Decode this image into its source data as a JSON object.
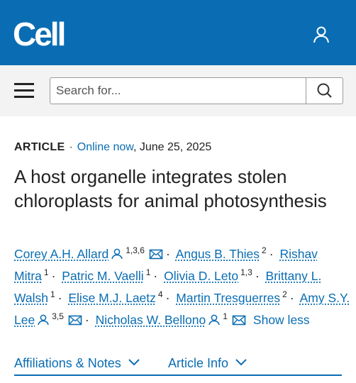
{
  "header": {
    "logo": "Cell",
    "user_icon": "user-icon",
    "brand_color": "#0a6db3"
  },
  "search": {
    "placeholder": "Search for...",
    "menu_icon": "hamburger-menu-icon",
    "search_icon": "magnifier-icon"
  },
  "article": {
    "type": "ARTICLE",
    "separator": "·",
    "online_label": "Online now",
    "date": ", June 25, 2025",
    "title": "A host organelle integrates stolen chloroplasts for animal photosynthesis"
  },
  "authors": [
    {
      "name": "Corey A.H. Allard",
      "sup": "1,3,6",
      "profile_icon": true,
      "email_icon": true
    },
    {
      "name": "Angus B. Thies",
      "sup": "2",
      "profile_icon": false,
      "email_icon": false
    },
    {
      "name": "Rishav Mitra",
      "sup": "1",
      "profile_icon": false,
      "email_icon": false
    },
    {
      "name": "Patric M. Vaelli",
      "sup": "1",
      "profile_icon": false,
      "email_icon": false
    },
    {
      "name": "Olivia D. Leto",
      "sup": "1,3",
      "profile_icon": false,
      "email_icon": false
    },
    {
      "name": "Brittany L. Walsh",
      "sup": "1",
      "profile_icon": false,
      "email_icon": false
    },
    {
      "name": "Elise M.J. Laetz",
      "sup": "4",
      "profile_icon": false,
      "email_icon": false
    },
    {
      "name": "Martin Tresguerres",
      "sup": "2",
      "profile_icon": false,
      "email_icon": false
    },
    {
      "name": "Amy S.Y. Lee",
      "sup": "3,5",
      "profile_icon": true,
      "email_icon": true
    },
    {
      "name": "Nicholas W. Bellono",
      "sup": "1",
      "profile_icon": true,
      "email_icon": true
    }
  ],
  "author_separator": "·",
  "show_less": "Show less",
  "tabs": [
    {
      "label": "Affiliations & Notes",
      "icon": "chevron-down-icon"
    },
    {
      "label": "Article Info",
      "icon": "chevron-down-icon"
    }
  ]
}
